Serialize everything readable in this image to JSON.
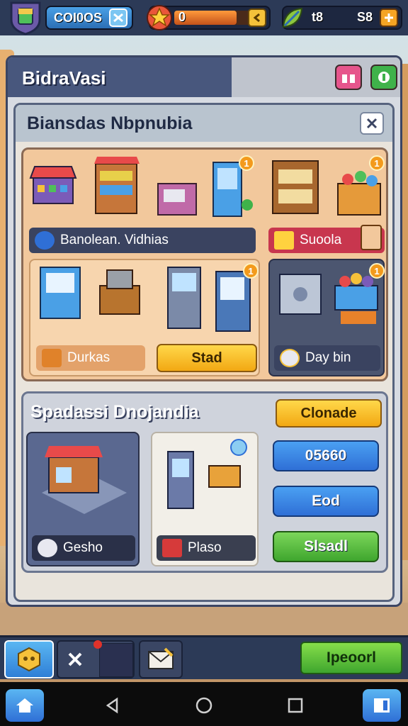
{
  "top_bar": {
    "currency_a": "COI0OS",
    "currency_b": "0",
    "currency_c_left": "t8",
    "currency_c_right": "S8"
  },
  "window": {
    "title": "BidraVasi",
    "panel_title": "Biansdas Nbpnubia",
    "shop": {
      "row1_label": "Banolean. Vidhias",
      "row1_tag": "Suoola",
      "row2_label": "Durkas",
      "row2_button": "Stad",
      "row2_right_label": "Day bin",
      "badge_a": "1",
      "badge_b": "1",
      "badge_c": "1",
      "badge_d": "1"
    },
    "special": {
      "title": "Spadassi Dnojandia",
      "top_button": "Clonade",
      "card_a_label": "Gesho",
      "card_b_label": "Plaso",
      "btn_1": "05660",
      "btn_2": "Eod",
      "btn_3": "Slsadl"
    }
  },
  "tab_bar": {
    "action_button": "Ipeoorl"
  },
  "colors": {
    "primary_dark": "#2c3a57",
    "accent_yellow": "#f2a813",
    "accent_blue": "#2f6fd6",
    "accent_green": "#4bb43a",
    "accent_red": "#d63a5a"
  }
}
